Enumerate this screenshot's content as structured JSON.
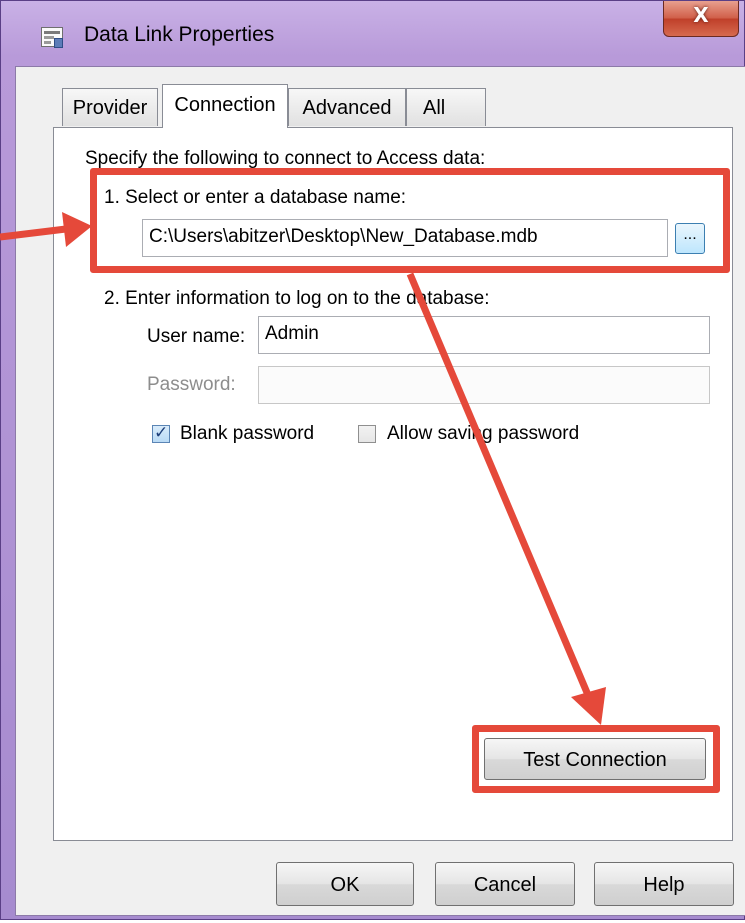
{
  "window": {
    "title": "Data Link Properties",
    "close_label": "X"
  },
  "tabs": [
    {
      "label": "Provider"
    },
    {
      "label": "Connection"
    },
    {
      "label": "Advanced"
    },
    {
      "label": "All"
    }
  ],
  "connection": {
    "intro": "Specify the following to connect to Access data:",
    "step1_label": "1. Select or enter a database name:",
    "database_path": "C:\\Users\\abitzer\\Desktop\\New_Database.mdb",
    "browse_label": "...",
    "step2_label": "2. Enter information to log on to the database:",
    "username_label": "User name:",
    "username_value": "Admin",
    "password_label": "Password:",
    "password_value": "",
    "blank_password_label": "Blank password",
    "blank_password_checked": true,
    "allow_saving_label": "Allow saving password",
    "allow_saving_checked": false,
    "test_connection_label": "Test Connection"
  },
  "footer": {
    "ok_label": "OK",
    "cancel_label": "Cancel",
    "help_label": "Help"
  },
  "annotation_color": "#e5493a"
}
